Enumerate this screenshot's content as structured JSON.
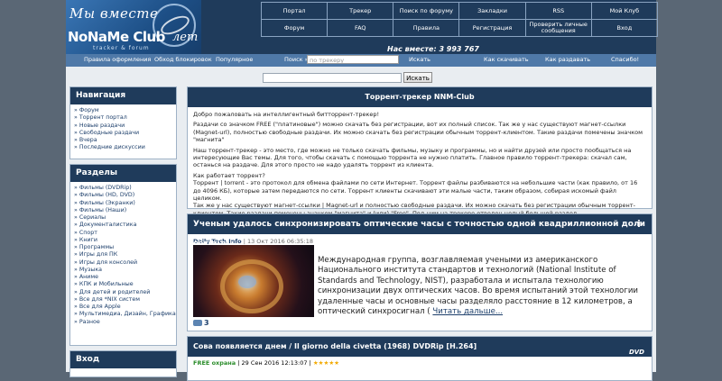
{
  "logo": {
    "line1": "Мы вместе",
    "name": "NoNaMe Club",
    "tagline": "tracker & forum",
    "suffix": "лет"
  },
  "topnav": [
    [
      "Портал",
      "Трекер",
      "Поиск по форуму",
      "Закладки",
      "RSS",
      "Мой Клуб"
    ],
    [
      "Форум",
      "FAQ",
      "Правила",
      "Регистрация",
      "Проверить личные сообщения",
      "Вход"
    ]
  ],
  "counter": "Нас вместе: 3 993 767",
  "bar": {
    "links_left": [
      "Правила оформления",
      "Обход блокировок",
      "Популярное"
    ],
    "search_label": "Поиск »",
    "search_placeholder": "по трекеру",
    "search_button": "Искать",
    "links_right": [
      "Как скачивать",
      "Как раздавать",
      "Спасибо!"
    ]
  },
  "search": {
    "button": "Искать"
  },
  "nav": {
    "title": "Навигация",
    "items": [
      "» Форум",
      "» Торрент портал",
      "» Новые раздачи",
      "» Свободные раздачи",
      "» Вчера",
      "» Последние дискуссии"
    ]
  },
  "sections": {
    "title": "Разделы",
    "items": [
      "» Фильмы (DVDRip)",
      "» Фильмы (HD, DVD)",
      "» Фильмы (Экранки)",
      "» Фильмы (Наши)",
      "» Сериалы",
      "» Документалистика",
      "» Спорт",
      "» Книги",
      "» Программы",
      "» Игры для ПК",
      "» Игры для консолей",
      "» Музыка",
      "» Аниме",
      "» КПК и Мобильные",
      "» Для детей и родителей",
      "» Все для *NIX систем",
      "» Все для Apple",
      "» Мультимедиа, Дизайн, Графика",
      "» Разное"
    ]
  },
  "login": {
    "title": "Вход"
  },
  "main": {
    "title": "Торрент-трекер NNM-Club",
    "intro": [
      "Добро пожаловать на интеллигентный битторрент-трекер!",
      "Раздачи со значком FREE (\"платиновые\") можно скачать без регистрации, вот их полный список. Так же у нас существуют магнет-ссылки (Magnet-url), полностью свободные раздачи. Их можно скачать без регистрации обычным торрент-клиентом. Такие раздачи помечены значком \"магнита\"",
      "Наш торрент-трекер - это место, где можно не только скачать фильмы, музыку и программы, но и найти друзей или просто пообщаться на интересующие Вас темы. Для того, чтобы скачать с помощью торрента не нужно платить. Главное правило торрент-трекера: скачал сам, останься на раздаче. Для этого просто не надо удалять торрент из клиента.",
      "Как работает торрент?",
      "Торрент | torrent - это протокол для обмена файлами по сети Интернет. Торрент файлы разбиваются на небольшие части (как правило, от 16 до 4096 КБ), которые затем передаются по сети. Торрент клиенты скачивают эти малые части, таким образом, собирая искомый файл целиком.",
      "Так же у нас существуют магнет-ссылки | Magnet-url и полностью свободные раздачи. Их можно скачать без регистрации обычным торрент-клиентом. Такие раздачи помечены значком \"магнита\" и (или) \"Free\". Под ним на трекере отведен целый большой раздел."
    ]
  },
  "news": {
    "title": "Ученым удалось синхронизировать оптические часы с точностью одной квадриллионной доли секунды",
    "source": "Daily.Tech.Info",
    "date": "| 13 Окт 2016 06:35:18",
    "text": "Международная группа, возглавляемая учеными из американского Национального института стандартов и технологий (National Institute of Standards and Technology, NIST), разработала и испытала технологию синхронизации двух оптических часов. Во время испытаний этой технологии удаленные часы и основные часы разделяло расстояние в 12 километров, а оптический синхросигнал ( ",
    "more": "Читать дальше...",
    "comments": "3"
  },
  "release": {
    "title": "Сова появляется днем / Il giorno della civetta (1968) DVDRip [H.264]",
    "badge": "DVD",
    "free": "FREE охрана",
    "date": "| 29 Сен 2016 12:13:07 |",
    "stars": "★★★★★"
  },
  "colors": {
    "header": "#1f3b5b",
    "bar": "#4f79a8",
    "page": "#e9edf1",
    "frame": "#5a6775"
  }
}
